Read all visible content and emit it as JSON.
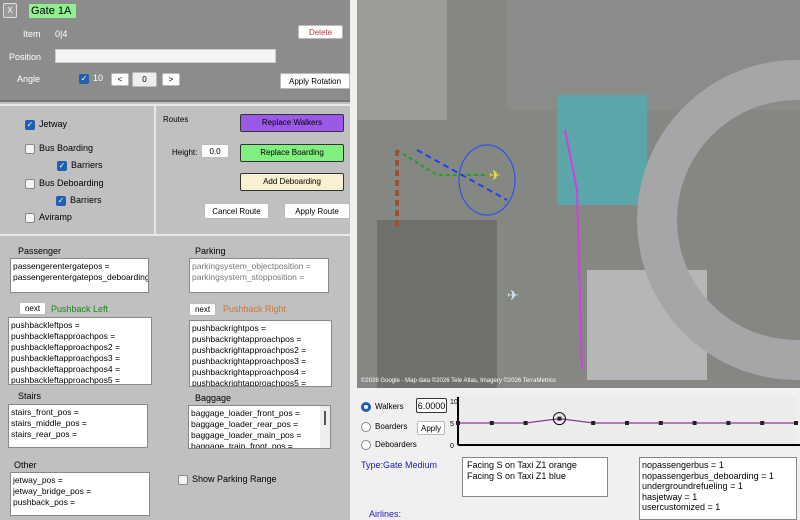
{
  "header": {
    "close_label": "X",
    "gate_name": "Gate 1A",
    "item_label": "Item",
    "item_value": "0|4",
    "delete_label": "Delete",
    "position_label": "Position",
    "position_value": "",
    "angle_label": "Angle",
    "angle_step": "10",
    "angle_step_checked": true,
    "prev_label": "<",
    "angle_value": "0",
    "next_label": ">",
    "apply_rotation_label": "Apply Rotation"
  },
  "options": {
    "jetway": "Jetway",
    "bus_boarding": "Bus Boarding",
    "barriers1": "Barriers",
    "bus_deboarding": "Bus Deboarding",
    "barriers2": "Barriers",
    "aviramp": "Aviramp"
  },
  "routes": {
    "label": "Routes",
    "height_label": "Height:",
    "height_value": "0.0",
    "replace_walkers": "Replace Walkers",
    "replace_boarding": "Replace Boarding",
    "add_deboarding": "Add Deboarding",
    "cancel_route": "Cancel Route",
    "apply_route": "Apply Route",
    "colors": {
      "walkers": "#9b59e8",
      "boarding": "#80f080",
      "deboarding": "#f8f0d0"
    }
  },
  "sections": {
    "passenger": {
      "label": "Passenger",
      "lines": [
        "passengerentergatepos =",
        "passengerentergatepos_deboarding ="
      ]
    },
    "parking": {
      "label": "Parking",
      "lines": [
        "parkingsystem_objectposition =",
        "parkingsystem_stopposition ="
      ]
    },
    "pushback_left": {
      "next": "next",
      "label": "Pushback Left",
      "color": "#1a8a1a",
      "lines": [
        "pushbackleftpos =",
        "pushbackleftapproachpos =",
        "pushbackleftapproachpos2 =",
        "pushbackleftapproachpos3 =",
        "pushbackleftapproachpos4 =",
        "pushbackleftapproachpos5 ="
      ]
    },
    "pushback_right": {
      "next": "next",
      "label": "Pushback Right",
      "color": "#c87840",
      "lines": [
        "pushbackrightpos =",
        "pushbackrightapproachpos =",
        "pushbackrightapproachpos2 =",
        "pushbackrightapproachpos3 =",
        "pushbackrightapproachpos4 =",
        "pushbackrightapproachpos5 ="
      ]
    },
    "stairs": {
      "label": "Stairs",
      "lines": [
        "stairs_front_pos =",
        "stairs_middle_pos =",
        "stairs_rear_pos ="
      ]
    },
    "baggage": {
      "label": "Baggage",
      "lines": [
        "baggage_loader_front_pos =",
        "baggage_loader_rear_pos =",
        "baggage_loader_main_pos =",
        "baggage_train_front_pos ="
      ]
    },
    "other": {
      "label": "Other",
      "lines": [
        "jetway_pos =",
        "jetway_bridge_pos =",
        "pushback_pos ="
      ]
    },
    "show_parking_range": "Show Parking Range"
  },
  "map": {
    "attribution": "©2026 Google - Map data ©2026 Tele Atlas, Imagery ©2026 TerraMetrics"
  },
  "bottom": {
    "walkers": "Walkers",
    "boarders": "Boarders",
    "deboarders": "Deboarders",
    "selected": "Walkers",
    "value": "6.0000",
    "apply": "Apply",
    "type": "Type:Gate Medium",
    "airlines": "Airlines:",
    "facing": [
      "Facing S on Taxi Z1 orange",
      "Facing S on Taxi Z1 blue"
    ],
    "props": [
      "nopassengerbus = 1",
      "nopassengerbus_deboarding = 1",
      "undergroundrefueling = 1",
      "hasjetway = 1",
      "usercustomized = 1"
    ]
  },
  "chart_data": {
    "type": "line",
    "ylim": [
      0,
      10
    ],
    "yticks": [
      "10",
      "5",
      "0"
    ],
    "values": [
      5,
      5,
      5,
      6,
      5,
      5,
      5,
      5,
      5,
      5,
      5
    ],
    "selected_index": 3,
    "line_color": "#8a3a8a"
  }
}
